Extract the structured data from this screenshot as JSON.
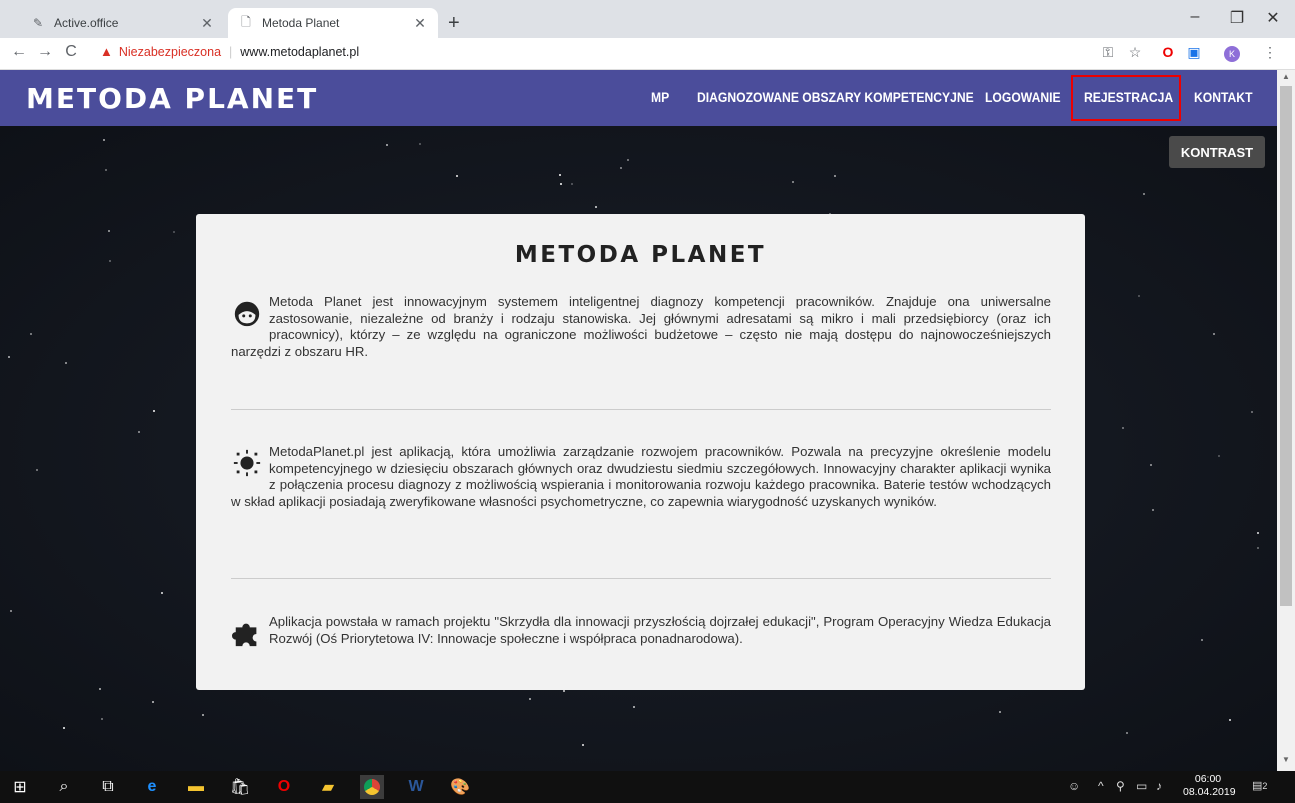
{
  "browser": {
    "tabs": [
      {
        "title": "Active.office"
      },
      {
        "title": "Metoda Planet"
      }
    ],
    "security_label": "Niezabezpieczona",
    "url": "www.metodaplanet.pl",
    "profile_initial": "K"
  },
  "site": {
    "logo": "METODA PLANET",
    "nav": [
      "MP",
      "DIAGNOZOWANE OBSZARY KOMPETENCYJNE",
      "LOGOWANIE",
      "REJESTRACJA",
      "KONTAKT"
    ],
    "contrast_button": "KONTRAST"
  },
  "card": {
    "title": "METODA PLANET",
    "paragraphs": [
      "Metoda Planet jest innowacyjnym systemem inteligentnej diagnozy kompetencji pracowników. Znajduje ona uniwersalne zastosowanie, niezależne od branży i rodzaju stanowiska. Jej głównymi adresatami są mikro i mali przedsiębiorcy (oraz ich pracownicy), którzy – ze względu na ograniczone możliwości budżetowe – często nie mają dostępu do najnowocześniejszych narzędzi z obszaru HR.",
      "MetodaPlanet.pl jest aplikacją, która umożliwia zarządzanie rozwojem pracowników. Pozwala na precyzyjne określenie modelu kompetencyjnego w dziesięciu obszarach głównych oraz dwudziestu siedmiu szczegółowych. Innowacyjny charakter aplikacji wynika z połączenia procesu diagnozy z możliwością wspierania i monitorowania rozwoju każdego pracownika. Baterie testów wchodzących w skład aplikacji posiadają zweryfikowane własności psychometryczne, co zapewnia wiarygodność uzyskanych wyników.",
      "Aplikacja powstała w ramach projektu \"Skrzydła dla innowacji przyszłością dojrzałej edukacji\", Program Operacyjny Wiedza Edukacja Rozwój (Oś Priorytetowa IV: Innowacje społeczne i współpraca ponadnarodowa)."
    ],
    "icons": [
      "face-icon",
      "sun-icon",
      "puzzle-icon"
    ]
  },
  "taskbar": {
    "time": "06:00",
    "date": "08.04.2019",
    "notifications": "2"
  },
  "colors": {
    "nav_bg": "#4b4d9b",
    "highlight": "#ee0000",
    "space_bg": "#12161e"
  }
}
